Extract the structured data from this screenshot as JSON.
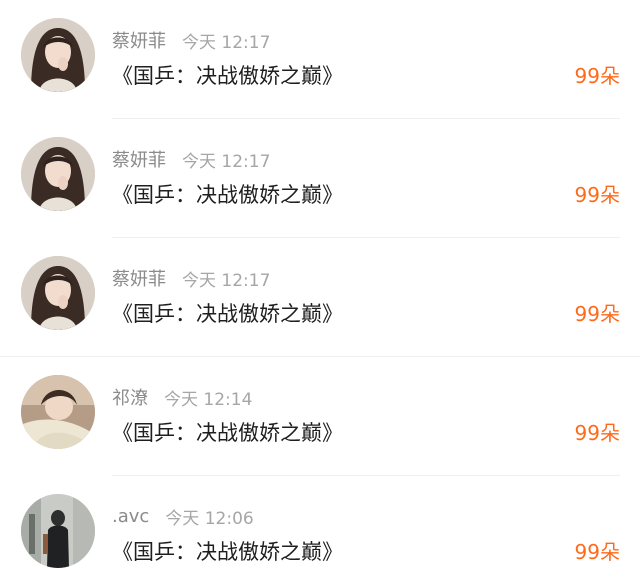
{
  "gift_list": {
    "items": [
      {
        "username": "蔡妍菲",
        "time": "今天 12:17",
        "message": "《国乒：决战傲娇之巅》",
        "gift": "99朵",
        "avatar": "girl-long-hair"
      },
      {
        "username": "蔡妍菲",
        "time": "今天 12:17",
        "message": "《国乒：决战傲娇之巅》",
        "gift": "99朵",
        "avatar": "girl-long-hair"
      },
      {
        "username": "蔡妍菲",
        "time": "今天 12:17",
        "message": "《国乒：决战傲娇之巅》",
        "gift": "99朵",
        "avatar": "girl-long-hair"
      },
      {
        "username": "祁潦",
        "time": "今天 12:14",
        "message": "《国乒：决战傲娇之巅》",
        "gift": "99朵",
        "avatar": "girl-lying"
      },
      {
        "username": ".avc",
        "time": "今天 12:06",
        "message": "《国乒：决战傲娇之巅》",
        "gift": "99朵",
        "avatar": "person-street"
      }
    ]
  },
  "colors": {
    "gift": "#ff6a1a",
    "username": "#8b8b8b",
    "time": "#a6a6a6",
    "message": "#1f1f1f"
  }
}
